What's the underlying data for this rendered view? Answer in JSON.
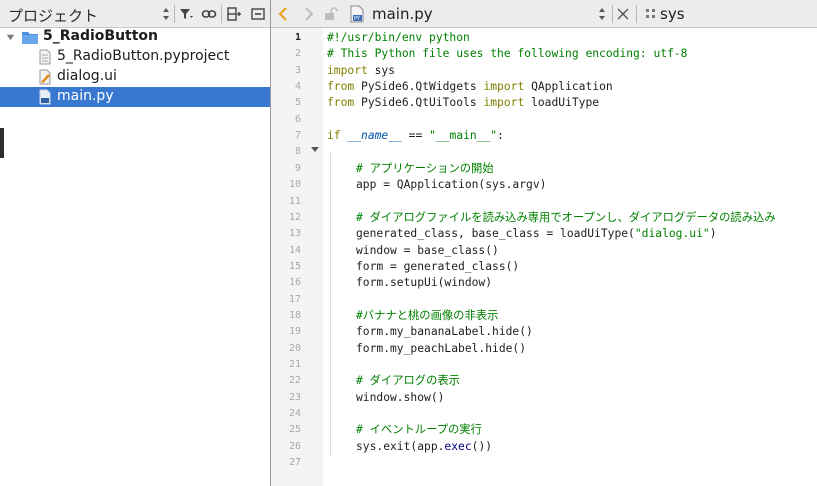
{
  "project_pane": {
    "title": "プロジェクト",
    "tree": [
      {
        "label": "5_RadioButton",
        "type": "folder",
        "expanded": true
      },
      {
        "label": "5_RadioButton.pyproject",
        "type": "file"
      },
      {
        "label": "dialog.ui",
        "type": "ui-file"
      },
      {
        "label": "main.py",
        "type": "python-file",
        "selected": true
      }
    ]
  },
  "editor": {
    "file_name": "main.py",
    "symbol": "sys",
    "current_line": 1,
    "lines": [
      {
        "n": "1",
        "parts": [
          {
            "t": "#!/usr/bin/env python",
            "c": "comment"
          }
        ]
      },
      {
        "n": "2",
        "parts": [
          {
            "t": "# This Python file uses the following encoding: utf-8",
            "c": "comment"
          }
        ]
      },
      {
        "n": "3",
        "parts": [
          {
            "t": "import",
            "c": "kw"
          },
          {
            "t": " sys",
            "c": ""
          }
        ]
      },
      {
        "n": "4",
        "parts": [
          {
            "t": "from",
            "c": "kw"
          },
          {
            "t": " PySide6.QtWidgets ",
            "c": ""
          },
          {
            "t": "import",
            "c": "kw"
          },
          {
            "t": " QApplication",
            "c": ""
          }
        ]
      },
      {
        "n": "5",
        "parts": [
          {
            "t": "from",
            "c": "kw"
          },
          {
            "t": " PySide6.QtUiTools ",
            "c": ""
          },
          {
            "t": "import",
            "c": "kw"
          },
          {
            "t": " loadUiType",
            "c": ""
          }
        ]
      },
      {
        "n": "6",
        "parts": []
      },
      {
        "n": "7",
        "parts": [
          {
            "t": "if",
            "c": "kw"
          },
          {
            "t": " ",
            "c": ""
          },
          {
            "t": "__name__",
            "c": "name"
          },
          {
            "t": " == ",
            "c": ""
          },
          {
            "t": "\"__main__\"",
            "c": "str"
          },
          {
            "t": ":",
            "c": ""
          }
        ]
      },
      {
        "n": "8",
        "parts": []
      },
      {
        "n": "9",
        "indent": true,
        "parts": [
          {
            "t": "# アプリケーションの開始",
            "c": "comment"
          }
        ]
      },
      {
        "n": "10",
        "indent": true,
        "parts": [
          {
            "t": "app = QApplication(sys.argv)",
            "c": ""
          }
        ]
      },
      {
        "n": "11",
        "parts": []
      },
      {
        "n": "12",
        "indent": true,
        "parts": [
          {
            "t": "# ダイアログファイルを読み込み専用でオープンし、ダイアログデータの読み込み",
            "c": "comment"
          }
        ]
      },
      {
        "n": "13",
        "indent": true,
        "parts": [
          {
            "t": "generated_class, base_class = loadUiType(",
            "c": ""
          },
          {
            "t": "\"dialog.ui\"",
            "c": "str"
          },
          {
            "t": ")",
            "c": ""
          }
        ]
      },
      {
        "n": "14",
        "indent": true,
        "parts": [
          {
            "t": "window = base_class()",
            "c": ""
          }
        ]
      },
      {
        "n": "15",
        "indent": true,
        "parts": [
          {
            "t": "form = generated_class()",
            "c": ""
          }
        ]
      },
      {
        "n": "16",
        "indent": true,
        "parts": [
          {
            "t": "form.setupUi(window)",
            "c": ""
          }
        ]
      },
      {
        "n": "17",
        "parts": []
      },
      {
        "n": "18",
        "indent": true,
        "parts": [
          {
            "t": "#バナナと桃の画像の非表示",
            "c": "comment"
          }
        ]
      },
      {
        "n": "19",
        "indent": true,
        "parts": [
          {
            "t": "form.my_bananaLabel.hide()",
            "c": ""
          }
        ]
      },
      {
        "n": "20",
        "indent": true,
        "parts": [
          {
            "t": "form.my_peachLabel.hide()",
            "c": ""
          }
        ]
      },
      {
        "n": "21",
        "parts": []
      },
      {
        "n": "22",
        "indent": true,
        "parts": [
          {
            "t": "# ダイアログの表示",
            "c": "comment"
          }
        ]
      },
      {
        "n": "23",
        "indent": true,
        "parts": [
          {
            "t": "window.show()",
            "c": ""
          }
        ]
      },
      {
        "n": "24",
        "parts": []
      },
      {
        "n": "25",
        "indent": true,
        "parts": [
          {
            "t": "# イベントループの実行",
            "c": "comment"
          }
        ]
      },
      {
        "n": "26",
        "indent": true,
        "parts": [
          {
            "t": "sys.exit(app.",
            "c": ""
          },
          {
            "t": "exec",
            "c": "builtin"
          },
          {
            "t": "())",
            "c": ""
          }
        ]
      },
      {
        "n": "27",
        "parts": []
      }
    ]
  },
  "icons": {
    "sort": "sort-updown-icon",
    "filter": "filter-icon",
    "link": "link-icon",
    "split": "split-icon",
    "collapse": "collapse-icon",
    "back": "back-arrow-icon",
    "forward": "forward-arrow-icon",
    "lock": "lock-icon",
    "python_file": "python-file-icon",
    "close": "close-icon",
    "symbol": "symbol-grid-icon"
  },
  "colors": {
    "selection": "#3878d0",
    "comment": "#008000",
    "keyword": "#808000",
    "back_arrow": "#e6a117"
  }
}
